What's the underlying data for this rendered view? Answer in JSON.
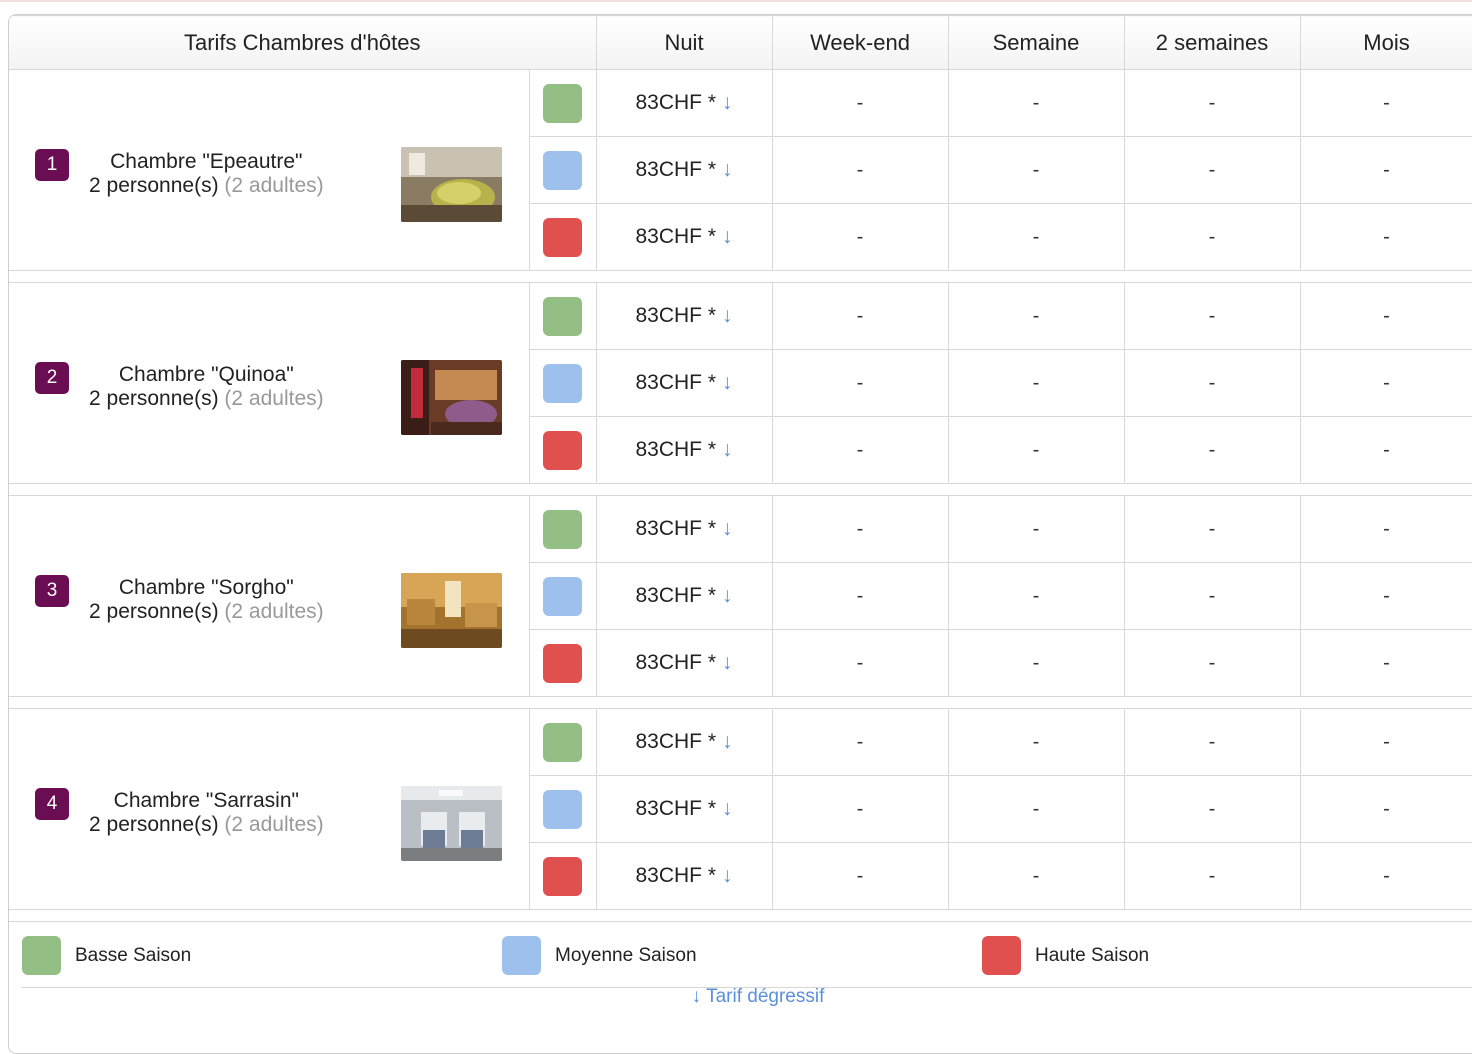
{
  "header": {
    "title": "Tarifs Chambres d'hôtes",
    "columns": [
      "Nuit",
      "Week-end",
      "Semaine",
      "2 semaines",
      "Mois"
    ]
  },
  "colors": {
    "basse": "#93bf85",
    "moyenne": "#9dc1ec",
    "haute": "#e0504f",
    "badge": "#6b0d52",
    "link": "#5b8fd9"
  },
  "rooms": [
    {
      "number": "1",
      "name": "Chambre \"Epeautre\"",
      "capacity": "2 personne(s)",
      "adults": "(2 adultes)",
      "thumb_icon": "room-photo-icon",
      "rates": [
        {
          "season": "basse",
          "nuit": "83CHF *",
          "weekend": "-",
          "semaine": "-",
          "deux_semaines": "-",
          "mois": "-"
        },
        {
          "season": "moyenne",
          "nuit": "83CHF *",
          "weekend": "-",
          "semaine": "-",
          "deux_semaines": "-",
          "mois": "-"
        },
        {
          "season": "haute",
          "nuit": "83CHF *",
          "weekend": "-",
          "semaine": "-",
          "deux_semaines": "-",
          "mois": "-"
        }
      ]
    },
    {
      "number": "2",
      "name": "Chambre \"Quinoa\"",
      "capacity": "2 personne(s)",
      "adults": "(2 adultes)",
      "thumb_icon": "room-photo-icon",
      "rates": [
        {
          "season": "basse",
          "nuit": "83CHF *",
          "weekend": "-",
          "semaine": "-",
          "deux_semaines": "-",
          "mois": "-"
        },
        {
          "season": "moyenne",
          "nuit": "83CHF *",
          "weekend": "-",
          "semaine": "-",
          "deux_semaines": "-",
          "mois": "-"
        },
        {
          "season": "haute",
          "nuit": "83CHF *",
          "weekend": "-",
          "semaine": "-",
          "deux_semaines": "-",
          "mois": "-"
        }
      ]
    },
    {
      "number": "3",
      "name": "Chambre \"Sorgho\"",
      "capacity": "2 personne(s)",
      "adults": "(2 adultes)",
      "thumb_icon": "room-photo-icon",
      "rates": [
        {
          "season": "basse",
          "nuit": "83CHF *",
          "weekend": "-",
          "semaine": "-",
          "deux_semaines": "-",
          "mois": "-"
        },
        {
          "season": "moyenne",
          "nuit": "83CHF *",
          "weekend": "-",
          "semaine": "-",
          "deux_semaines": "-",
          "mois": "-"
        },
        {
          "season": "haute",
          "nuit": "83CHF *",
          "weekend": "-",
          "semaine": "-",
          "deux_semaines": "-",
          "mois": "-"
        }
      ]
    },
    {
      "number": "4",
      "name": "Chambre \"Sarrasin\"",
      "capacity": "2 personne(s)",
      "adults": "(2 adultes)",
      "thumb_icon": "room-photo-icon",
      "rates": [
        {
          "season": "basse",
          "nuit": "83CHF *",
          "weekend": "-",
          "semaine": "-",
          "deux_semaines": "-",
          "mois": "-"
        },
        {
          "season": "moyenne",
          "nuit": "83CHF *",
          "weekend": "-",
          "semaine": "-",
          "deux_semaines": "-",
          "mois": "-"
        },
        {
          "season": "haute",
          "nuit": "83CHF *",
          "weekend": "-",
          "semaine": "-",
          "deux_semaines": "-",
          "mois": "-"
        }
      ]
    }
  ],
  "rate_arrow": "↓",
  "legend": {
    "basse": "Basse Saison",
    "moyenne": "Moyenne Saison",
    "haute": "Haute Saison"
  },
  "degressive_link": "↓ Tarif dégressif"
}
